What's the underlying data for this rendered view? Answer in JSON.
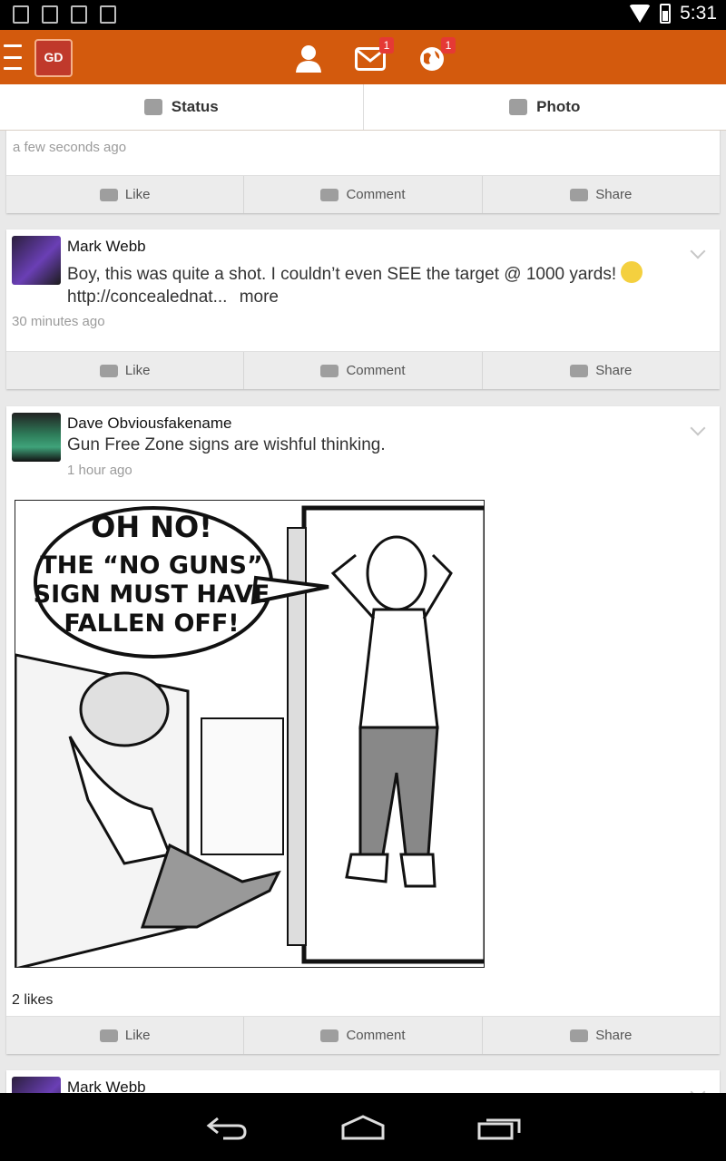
{
  "status_bar": {
    "time": "5:31"
  },
  "header": {
    "logo_text": "GD",
    "badges": {
      "messages": "1",
      "notifications": "1"
    }
  },
  "tabs": [
    {
      "label": "Status"
    },
    {
      "label": "Photo"
    }
  ],
  "actions": {
    "like": "Like",
    "comment": "Comment",
    "share": "Share"
  },
  "posts": [
    {
      "time": "a few seconds ago"
    },
    {
      "author": "Mark Webb",
      "text_line1": "Boy, this was quite a shot. I couldn’t even SEE the target @ 1000 yards!",
      "link": "http://concealednat...",
      "more": "more",
      "time": "30 minutes ago"
    },
    {
      "author": "Dave Obviousfakename",
      "text": "Gun Free Zone signs are wishful thinking.",
      "time": "1 hour ago",
      "comic_text": [
        "OH NO!",
        "THE “NO GUNS”",
        "SIGN MUST HAVE",
        "FALLEN OFF!"
      ],
      "likes": "2 likes"
    },
    {
      "author": "Mark Webb"
    }
  ]
}
